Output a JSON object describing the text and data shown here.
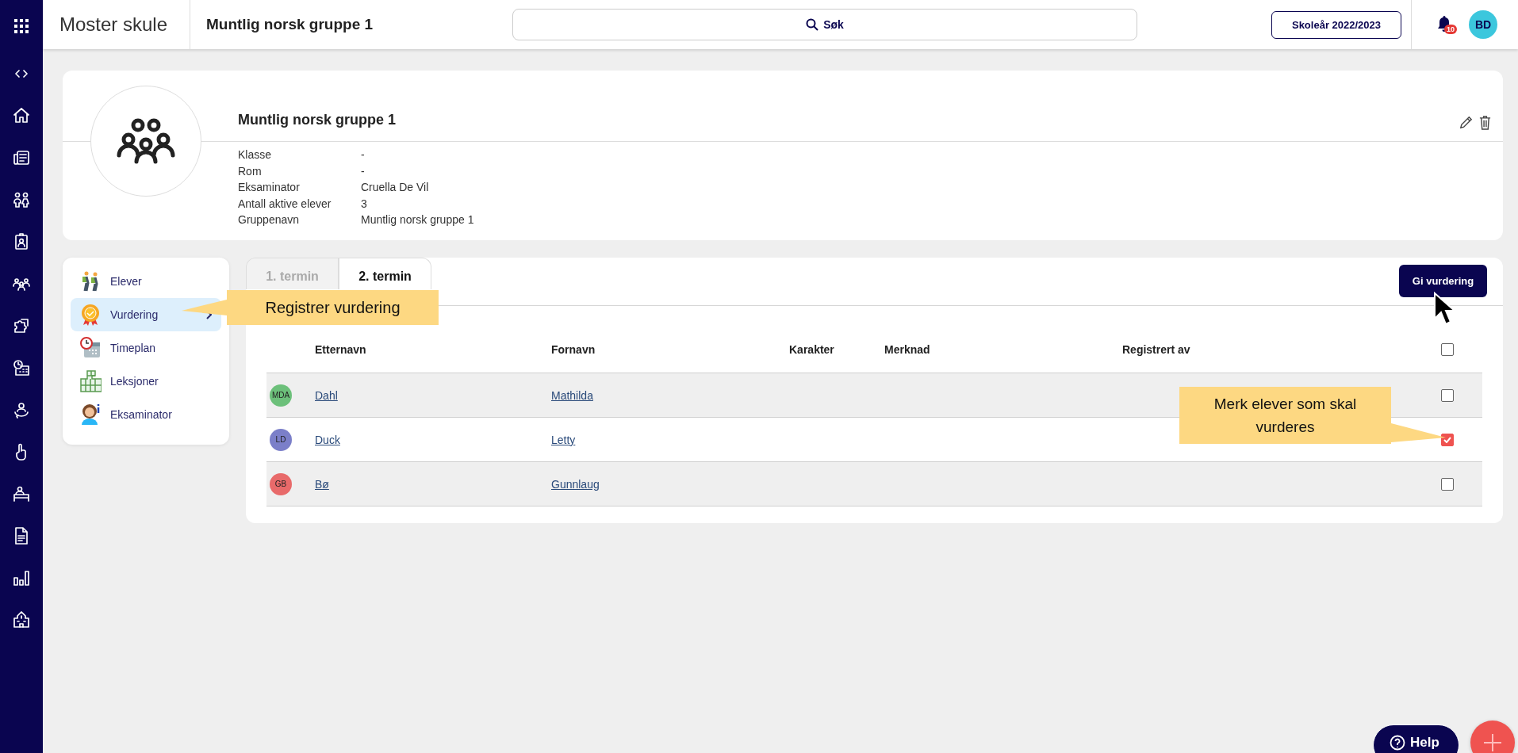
{
  "app_bar": {
    "school": "Moster skule",
    "group": "Muntlig norsk gruppe 1",
    "search": {
      "label": "Søk"
    },
    "school_year": "Skoleår 2022/2023",
    "notifications": {
      "count": "10"
    },
    "user": {
      "initials": "BD"
    }
  },
  "group_card": {
    "title": "Muntlig norsk gruppe 1",
    "details": [
      {
        "label": "Klasse",
        "value": "-"
      },
      {
        "label": "Rom",
        "value": "-"
      },
      {
        "label": "Eksaminator",
        "value": "Cruella De Vil"
      },
      {
        "label": "Antall aktive elever",
        "value": "3"
      },
      {
        "label": "Gruppenavn",
        "value": "Muntlig norsk gruppe 1"
      }
    ]
  },
  "menu": {
    "items": [
      {
        "kind": "students",
        "label": "Elever",
        "selected": false
      },
      {
        "kind": "assessment",
        "label": "Vurdering",
        "selected": true
      },
      {
        "kind": "schedule",
        "label": "Timeplan",
        "selected": false
      },
      {
        "kind": "lessons",
        "label": "Leksjoner",
        "selected": false
      },
      {
        "kind": "examiner",
        "label": "Eksaminator",
        "selected": false
      }
    ]
  },
  "tabs": [
    {
      "label": "1. termin",
      "selected": false
    },
    {
      "label": "2. termin",
      "selected": true
    }
  ],
  "action_button": "Gi vurdering",
  "table": {
    "columns": [
      "Etternavn",
      "Fornavn",
      "Karakter",
      "Merknad",
      "Registrert av"
    ],
    "select_all": {
      "checked": false
    },
    "rows": [
      {
        "initials": "MDA",
        "color": "#6cc07a",
        "last_name": "Dahl",
        "first_name": "Mathilda",
        "checked": false
      },
      {
        "initials": "LD",
        "color": "#7b7fc9",
        "last_name": "Duck",
        "first_name": "Letty",
        "checked": true
      },
      {
        "initials": "GB",
        "color": "#e86a6a",
        "last_name": "Bø",
        "first_name": "Gunnlaug",
        "checked": false
      }
    ]
  },
  "callouts": [
    {
      "text": "Registrer vurdering"
    },
    {
      "text": "Merk elever som skal vurderes"
    }
  ],
  "help_button": "Help"
}
